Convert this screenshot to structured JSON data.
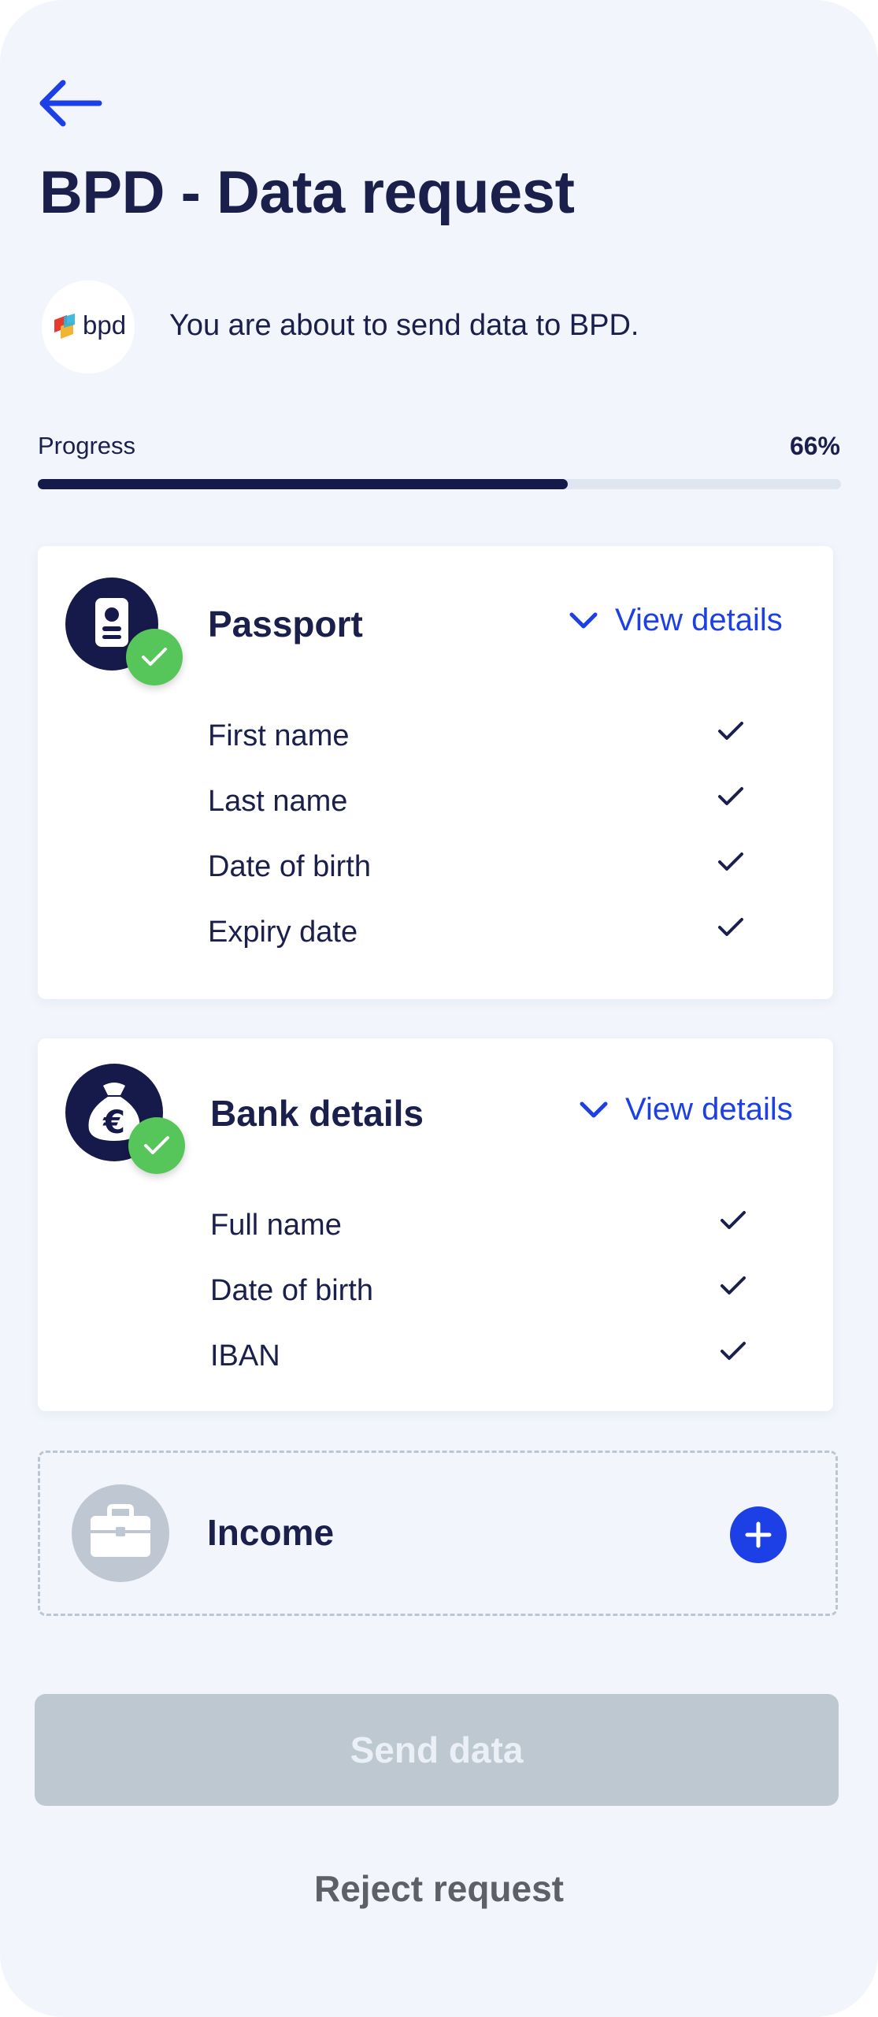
{
  "header": {
    "title": "BPD - Data request",
    "back_icon": "arrow-left-icon"
  },
  "requester": {
    "logo_text": "bpd",
    "message": "You are about to send data to BPD."
  },
  "progress": {
    "label": "Progress",
    "value_text": "66%",
    "fraction": 0.66
  },
  "cards": {
    "passport": {
      "title": "Passport",
      "icon": "passport-icon",
      "details_label": "View details",
      "fields": [
        {
          "label": "First name"
        },
        {
          "label": "Last name"
        },
        {
          "label": "Date of birth"
        },
        {
          "label": "Expiry date"
        }
      ]
    },
    "bank": {
      "title": "Bank details",
      "icon": "money-bag-euro-icon",
      "details_label": "View details",
      "fields": [
        {
          "label": "Full name"
        },
        {
          "label": "Date of birth"
        },
        {
          "label": "IBAN"
        }
      ]
    },
    "income": {
      "title": "Income",
      "icon": "briefcase-icon"
    }
  },
  "actions": {
    "send_label": "Send data",
    "reject_label": "Reject request"
  },
  "colors": {
    "primary_blue": "#1d3fe6",
    "navy": "#161a4a",
    "success_green": "#57c65a",
    "disabled_button": "#bec8d1",
    "background": "#f2f5fb"
  }
}
